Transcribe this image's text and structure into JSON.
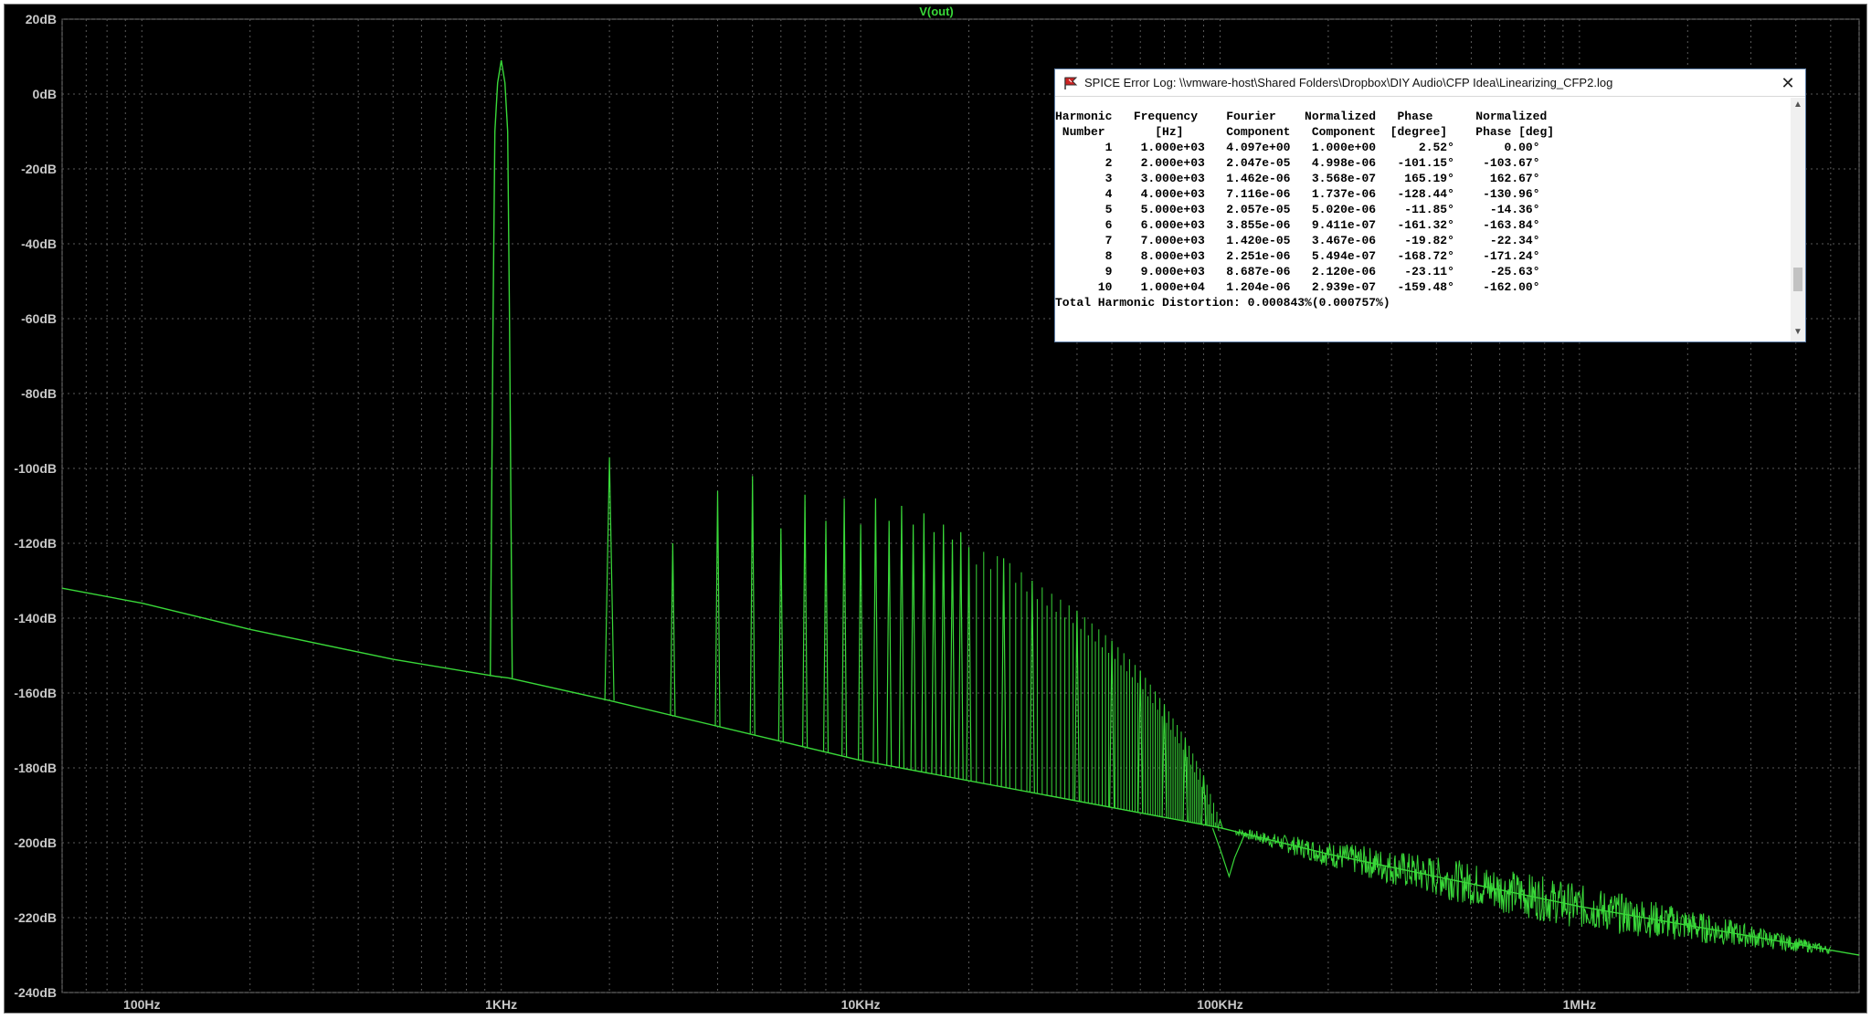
{
  "window": {
    "title": "SPICE Error Log: \\\\vmware-host\\Shared Folders\\Dropbox\\DIY Audio\\CFP Idea\\Linearizing_CFP2.log",
    "close_icon": "✕"
  },
  "log": {
    "header_lines": [
      "Harmonic   Frequency    Fourier    Normalized   Phase      Normalized",
      " Number       [Hz]      Component   Component  [degree]    Phase [deg]"
    ],
    "rows": [
      [
        "1",
        "1.000e+03",
        "4.097e+00",
        "1.000e+00",
        "2.52°",
        "0.00°"
      ],
      [
        "2",
        "2.000e+03",
        "2.047e-05",
        "4.998e-06",
        "-101.15°",
        "-103.67°"
      ],
      [
        "3",
        "3.000e+03",
        "1.462e-06",
        "3.568e-07",
        "165.19°",
        "162.67°"
      ],
      [
        "4",
        "4.000e+03",
        "7.116e-06",
        "1.737e-06",
        "-128.44°",
        "-130.96°"
      ],
      [
        "5",
        "5.000e+03",
        "2.057e-05",
        "5.020e-06",
        "-11.85°",
        "-14.36°"
      ],
      [
        "6",
        "6.000e+03",
        "3.855e-06",
        "9.411e-07",
        "-161.32°",
        "-163.84°"
      ],
      [
        "7",
        "7.000e+03",
        "1.420e-05",
        "3.467e-06",
        "-19.82°",
        "-22.34°"
      ],
      [
        "8",
        "8.000e+03",
        "2.251e-06",
        "5.494e-07",
        "-168.72°",
        "-171.24°"
      ],
      [
        "9",
        "9.000e+03",
        "8.687e-06",
        "2.120e-06",
        "-23.11°",
        "-25.63°"
      ],
      [
        "10",
        "1.000e+04",
        "1.204e-06",
        "2.939e-07",
        "-159.48°",
        "-162.00°"
      ]
    ],
    "footer": "Total Harmonic Distortion: 0.000843%(0.000757%)"
  },
  "chart_data": {
    "type": "line",
    "title": "V(out)",
    "x_scale": "log",
    "xlim": [
      60,
      6000000
    ],
    "ylim": [
      -240,
      20
    ],
    "x_ticks": [
      {
        "value": 100,
        "label": "100Hz"
      },
      {
        "value": 1000,
        "label": "1KHz"
      },
      {
        "value": 10000,
        "label": "10KHz"
      },
      {
        "value": 100000,
        "label": "100KHz"
      },
      {
        "value": 1000000,
        "label": "1MHz"
      }
    ],
    "y_ticks": [
      {
        "value": 20,
        "label": "20dB"
      },
      {
        "value": 0,
        "label": "0dB"
      },
      {
        "value": -20,
        "label": "-20dB"
      },
      {
        "value": -40,
        "label": "-40dB"
      },
      {
        "value": -60,
        "label": "-60dB"
      },
      {
        "value": -80,
        "label": "-80dB"
      },
      {
        "value": -100,
        "label": "-100dB"
      },
      {
        "value": -120,
        "label": "-120dB"
      },
      {
        "value": -140,
        "label": "-140dB"
      },
      {
        "value": -160,
        "label": "-160dB"
      },
      {
        "value": -180,
        "label": "-180dB"
      },
      {
        "value": -200,
        "label": "-200dB"
      },
      {
        "value": -220,
        "label": "-220dB"
      },
      {
        "value": -240,
        "label": "-240dB"
      }
    ],
    "grid": true,
    "color": "#39d839",
    "noise_floor": [
      [
        60,
        -132
      ],
      [
        100,
        -136
      ],
      [
        200,
        -143
      ],
      [
        500,
        -151
      ],
      [
        960,
        -155.5
      ],
      [
        1050,
        -156
      ],
      [
        2000,
        -162
      ],
      [
        10000,
        -178
      ],
      [
        100000,
        -196
      ],
      [
        200000,
        -203
      ],
      [
        1000000,
        -217
      ],
      [
        6000000,
        -230
      ]
    ],
    "harmonic_peaks": [
      [
        1000,
        9
      ],
      [
        2000,
        -97
      ],
      [
        3000,
        -120
      ],
      [
        4000,
        -106
      ],
      [
        5000,
        -102
      ],
      [
        6000,
        -116
      ],
      [
        7000,
        -107
      ],
      [
        8000,
        -114
      ],
      [
        9000,
        -108
      ],
      [
        10000,
        -115
      ],
      [
        11000,
        -108
      ],
      [
        12000,
        -114
      ],
      [
        13000,
        -110
      ],
      [
        14000,
        -115
      ],
      [
        15000,
        -112
      ],
      [
        16000,
        -117
      ],
      [
        17000,
        -115
      ],
      [
        18000,
        -119
      ],
      [
        19000,
        -117
      ],
      [
        20000,
        -121
      ],
      [
        25000,
        -124
      ],
      [
        30000,
        -130
      ],
      [
        40000,
        -138
      ],
      [
        50000,
        -146
      ],
      [
        60000,
        -154
      ],
      [
        70000,
        -163
      ],
      [
        80000,
        -172
      ],
      [
        90000,
        -182
      ],
      [
        100000,
        -194
      ]
    ],
    "dip": [
      106000,
      -209
    ]
  }
}
